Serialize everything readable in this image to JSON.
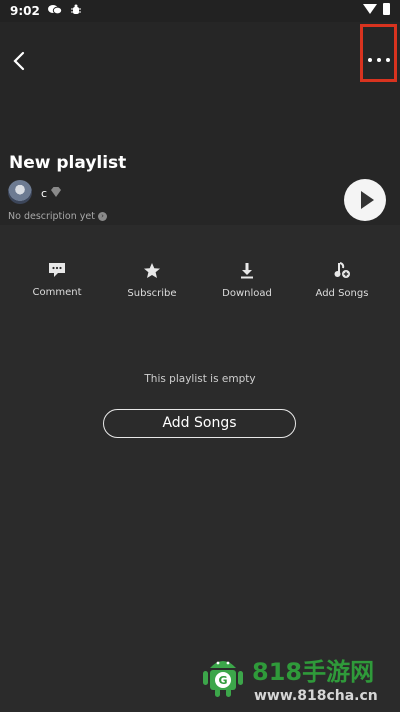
{
  "status_bar": {
    "time": "9:02",
    "wechat_icon": "wechat-icon",
    "app_icon": "bug-icon"
  },
  "playlist": {
    "title": "New playlist",
    "owner": "c",
    "description": "No description yet",
    "description_arrow": "›"
  },
  "actions": [
    {
      "label": "Comment",
      "icon": "comment-icon"
    },
    {
      "label": "Subscribe",
      "icon": "star-icon"
    },
    {
      "label": "Download",
      "icon": "download-icon"
    },
    {
      "label": "Add Songs",
      "icon": "add-music-icon"
    }
  ],
  "empty_state": {
    "text": "This playlist is empty",
    "button_label": "Add Songs"
  },
  "watermark": {
    "name": "818手游网",
    "url": "www.818cha.cn"
  },
  "colors": {
    "highlight": "#d8331f",
    "background": "#2b2b2b",
    "watermark_green": "#2f9a3a"
  }
}
